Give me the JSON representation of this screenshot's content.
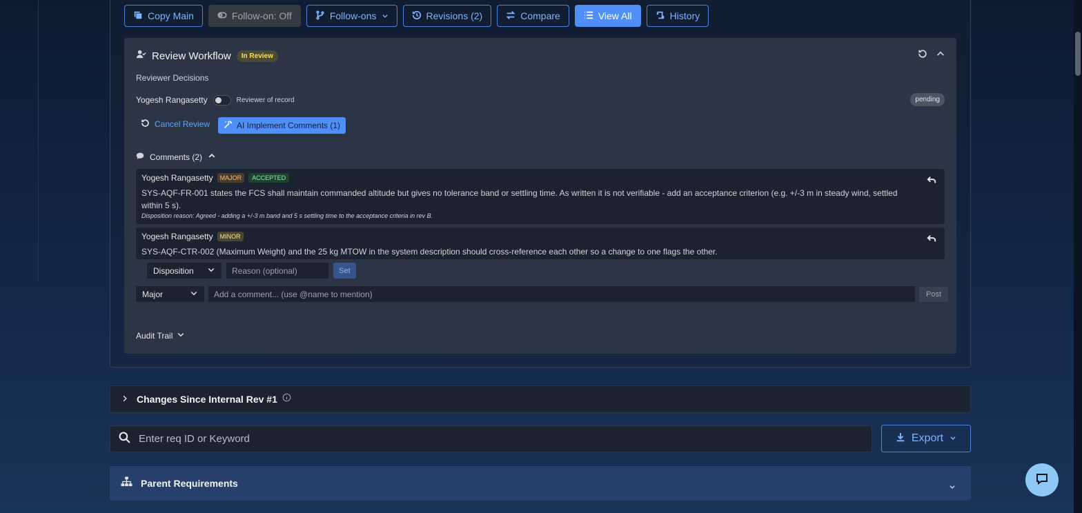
{
  "toolbar": {
    "copy_main": "Copy Main",
    "follow_on_toggle": "Follow-on: Off",
    "follow_ons": "Follow-ons",
    "revisions": "Revisions (2)",
    "compare": "Compare",
    "view_all": "View All",
    "history": "History"
  },
  "workflow": {
    "title": "Review Workflow",
    "status_badge": "In Review",
    "reviewer_decisions_label": "Reviewer Decisions",
    "reviewer": {
      "name": "Yogesh Rangasetty",
      "toggle_label": "Reviewer of record",
      "status": "pending"
    },
    "cancel_review": "Cancel Review",
    "ai_implement": "AI Implement Comments (1)",
    "comments_header": "Comments (2)",
    "comments": [
      {
        "author": "Yogesh Rangasetty",
        "severity": "MAJOR",
        "status": "ACCEPTED",
        "text": "SYS-AQF-FR-001 states the FCS shall maintain commanded altitude but gives no tolerance band or settling time. As written it is not verifiable - add an acceptance criterion (e.g. +/-3 m in steady wind, settled within 5 s).",
        "disposition": "Disposition reason: Agreed - adding a +/-3 m band and 5 s settling time to the acceptance criteria in rev B."
      },
      {
        "author": "Yogesh Rangasetty",
        "severity": "MINOR",
        "text": "SYS-AQF-CTR-002 (Maximum Weight) and the 25 kg MTOW in the system description should cross-reference each other so a change to one flags the other."
      }
    ],
    "disposition_form": {
      "select_value": "Disposition",
      "reason_placeholder": "Reason (optional)",
      "set_label": "Set"
    },
    "new_comment": {
      "severity_value": "Major",
      "placeholder": "Add a comment... (use @name to mention)",
      "post_label": "Post"
    },
    "audit_trail": "Audit Trail"
  },
  "changes_section": {
    "title": "Changes Since Internal Rev #1"
  },
  "search": {
    "placeholder": "Enter req ID or Keyword"
  },
  "export": {
    "label": "Export"
  },
  "parent_requirements": {
    "title": "Parent Requirements"
  },
  "colors": {
    "accent": "#4f8ff7",
    "link": "#7fb2ff",
    "panel": "#2b3545",
    "comment_bg": "#1b2230"
  }
}
